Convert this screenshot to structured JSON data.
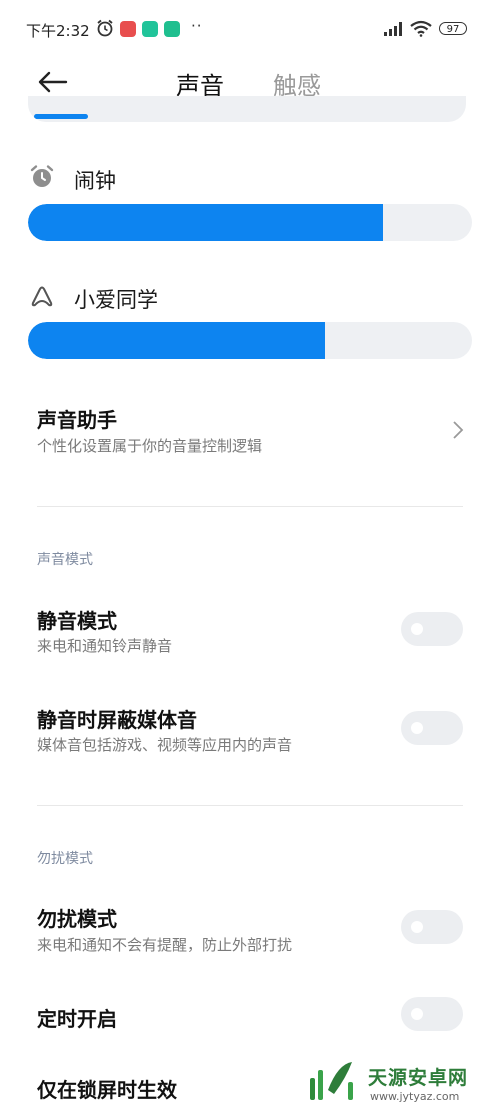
{
  "status_bar": {
    "time": "下午2:32",
    "battery": "97",
    "more": "··"
  },
  "header": {
    "tabs": [
      {
        "label": "声音",
        "active": true
      },
      {
        "label": "触感",
        "active": false
      }
    ]
  },
  "volume": {
    "previous_level": 0.13,
    "alarm": {
      "label": "闹钟",
      "icon": "alarm-clock-icon",
      "level": 0.8
    },
    "xiaoai": {
      "label": "小爱同学",
      "icon": "xiaoai-icon",
      "level": 0.67
    }
  },
  "assistant": {
    "title": "声音助手",
    "subtitle": "个性化设置属于你的音量控制逻辑"
  },
  "sound_mode": {
    "header": "声音模式",
    "items": [
      {
        "title": "静音模式",
        "subtitle": "来电和通知铃声静音",
        "on": false
      },
      {
        "title": "静音时屏蔽媒体音",
        "subtitle": "媒体音包括游戏、视频等应用内的声音",
        "on": false
      }
    ]
  },
  "dnd_mode": {
    "header": "勿扰模式",
    "items": [
      {
        "title": "勿扰模式",
        "subtitle": "来电和通知不会有提醒，防止外部打扰",
        "on": false
      },
      {
        "title": "定时开启",
        "on": false
      },
      {
        "title": "仅在锁屏时生效"
      }
    ]
  },
  "watermark": {
    "title": "天源安卓网",
    "url": "www.jytyaz.com"
  },
  "colors": {
    "accent": "#0d84f0",
    "track": "#eef0f3",
    "toggle_off": "#eceef1",
    "section_header": "#7f8ba0"
  }
}
